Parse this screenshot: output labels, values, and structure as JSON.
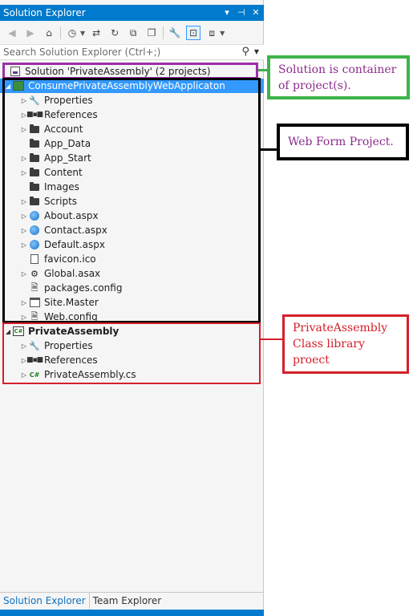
{
  "window": {
    "title": "Solution Explorer",
    "buttons": [
      "▾",
      "⊣",
      "✕"
    ]
  },
  "toolbar": {
    "icons": [
      "back-icon",
      "forward-icon",
      "home-icon",
      "history-icon",
      "sync-icon",
      "refresh-icon",
      "collapse-all-icon",
      "show-all-files-icon",
      "properties-icon",
      "preview-icon",
      "class-view-icon"
    ]
  },
  "search": {
    "placeholder": "Search Solution Explorer (Ctrl+;)"
  },
  "tree": {
    "solution": "Solution 'PrivateAssembly' (2 projects)",
    "web_project": "ConsumePrivateAssemblyWebApplicaton",
    "web_items": [
      {
        "label": "Properties",
        "icon": "wrench-icon"
      },
      {
        "label": "References",
        "icon": "references-icon"
      },
      {
        "label": "Account",
        "icon": "folder-icon"
      },
      {
        "label": "App_Data",
        "icon": "folder-icon"
      },
      {
        "label": "App_Start",
        "icon": "folder-icon"
      },
      {
        "label": "Content",
        "icon": "folder-icon"
      },
      {
        "label": "Images",
        "icon": "folder-icon"
      },
      {
        "label": "Scripts",
        "icon": "folder-icon"
      },
      {
        "label": "About.aspx",
        "icon": "aspx-globe-icon"
      },
      {
        "label": "Contact.aspx",
        "icon": "aspx-globe-icon"
      },
      {
        "label": "Default.aspx",
        "icon": "aspx-globe-icon"
      },
      {
        "label": "favicon.ico",
        "icon": "file-icon"
      },
      {
        "label": "Global.asax",
        "icon": "asax-icon"
      },
      {
        "label": "packages.config",
        "icon": "config-icon"
      },
      {
        "label": "Site.Master",
        "icon": "master-page-icon"
      },
      {
        "label": "Web.config",
        "icon": "config-icon"
      }
    ],
    "lib_project": "PrivateAssembly",
    "lib_items": [
      {
        "label": "Properties",
        "icon": "wrench-icon"
      },
      {
        "label": "References",
        "icon": "references-icon"
      },
      {
        "label": "PrivateAssembly.cs",
        "icon": "csharp-file-icon"
      }
    ]
  },
  "bottom_tabs": {
    "active": "Solution Explorer",
    "inactive": "Team Explorer"
  },
  "annotations": {
    "solution": {
      "line1": "Solution is container",
      "line2": "of project(s).",
      "color": "#3db34a",
      "text_color": "#8b2b8b"
    },
    "web_project": {
      "line1": "Web Form Project.",
      "color": "#000000",
      "text_color": "#8b2b8b"
    },
    "lib_project": {
      "line1": "PrivateAssembly",
      "line2": "Class library proect",
      "color": "#d4202a",
      "text_color": "#d4202a"
    },
    "solution_highlight_color": "#9b30a6",
    "accent": "#007acc",
    "selection": "#3399ff"
  }
}
